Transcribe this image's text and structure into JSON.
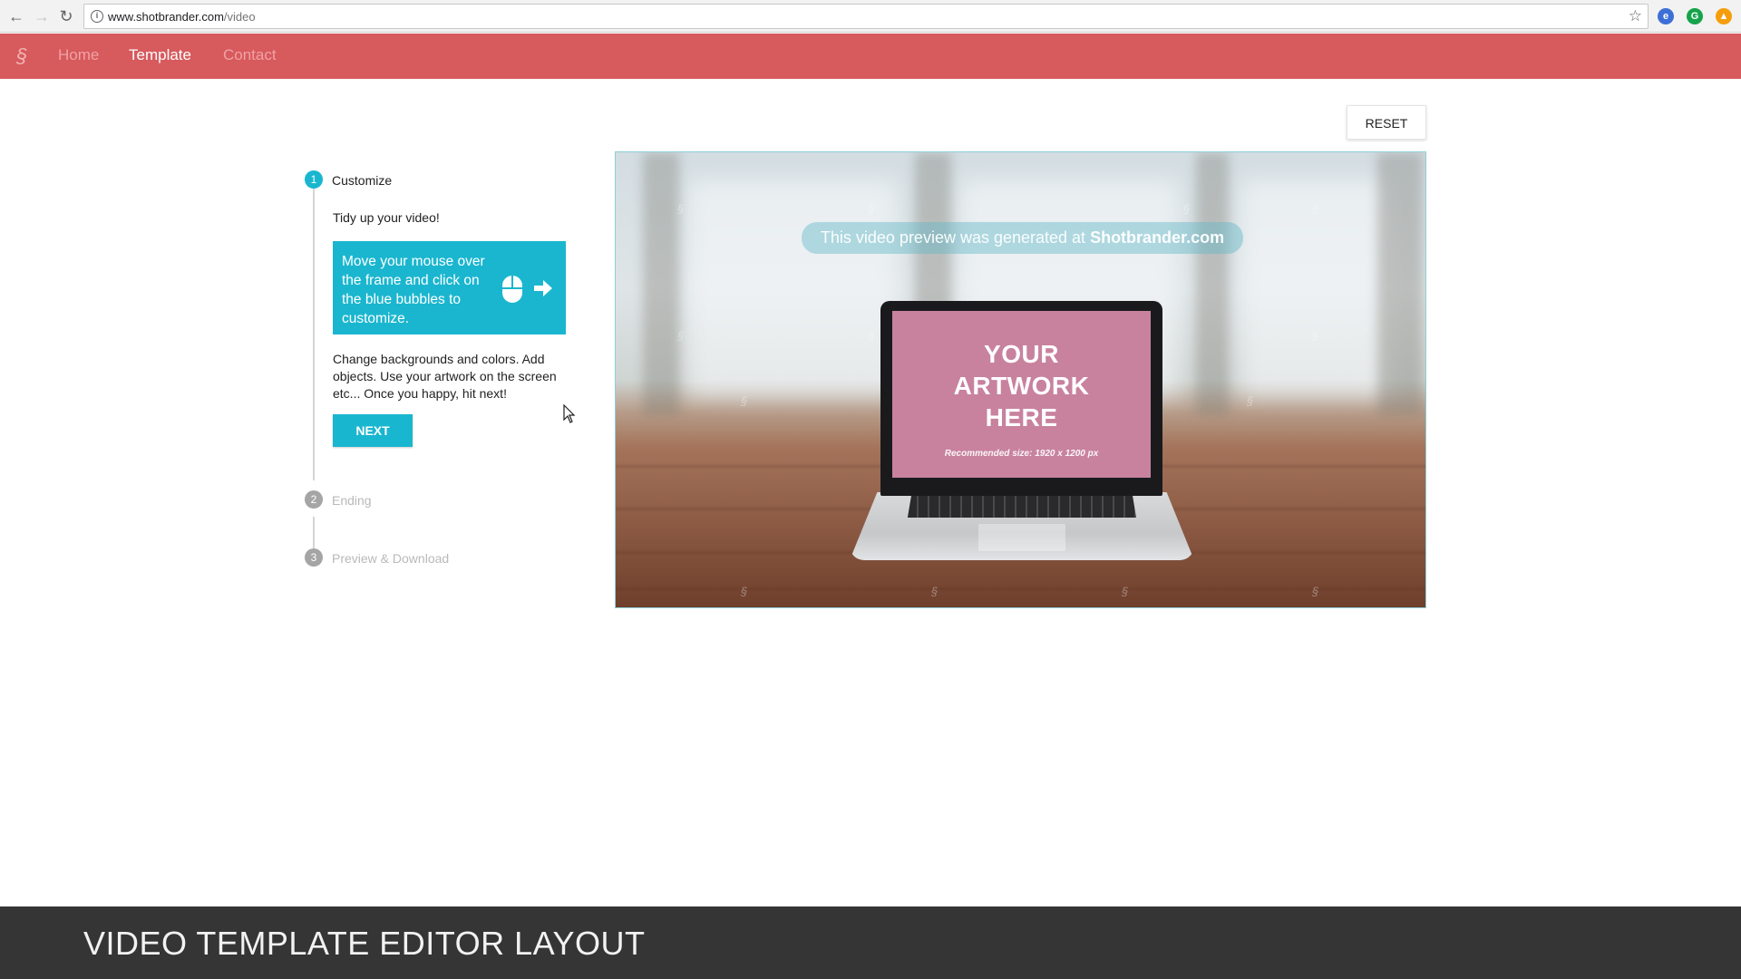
{
  "browser": {
    "url_domain": "www.shotbrander.com",
    "url_path": "/video",
    "back_icon": "back-arrow-icon",
    "forward_icon": "forward-arrow-icon",
    "reload_icon": "reload-icon",
    "bookmark_icon": "star-icon"
  },
  "nav": {
    "logo": "§",
    "links": [
      {
        "label": "Home",
        "active": false
      },
      {
        "label": "Template",
        "active": true
      },
      {
        "label": "Contact",
        "active": false
      }
    ],
    "bar_color": "#d75a5d"
  },
  "toolbar": {
    "reset_label": "RESET"
  },
  "steps": [
    {
      "number": "1",
      "title": "Customize",
      "active": true
    },
    {
      "number": "2",
      "title": "Ending",
      "active": false
    },
    {
      "number": "3",
      "title": "Preview & Download",
      "active": false
    }
  ],
  "customize": {
    "intro": "Tidy up your video!",
    "hint": "Move your mouse over the frame and click on the blue bubbles to customize.",
    "hint_icons": [
      "mouse-icon",
      "arrow-right-icon"
    ],
    "description": "Change backgrounds and colors. Add objects. Use your artwork on the screen etc... Once you happy, hit next!",
    "next_label": "NEXT",
    "accent_color": "#19b6cf"
  },
  "preview": {
    "watermark_prefix": "This video preview was generated at ",
    "watermark_brand": "Shotbrander.com",
    "artwork_line1": "YOUR",
    "artwork_line2": "ARTWORK",
    "artwork_line3": "HERE",
    "artwork_subtitle": "Recommended size: 1920 x 1200 px"
  },
  "footer": {
    "title": "VIDEO TEMPLATE EDITOR LAYOUT"
  }
}
